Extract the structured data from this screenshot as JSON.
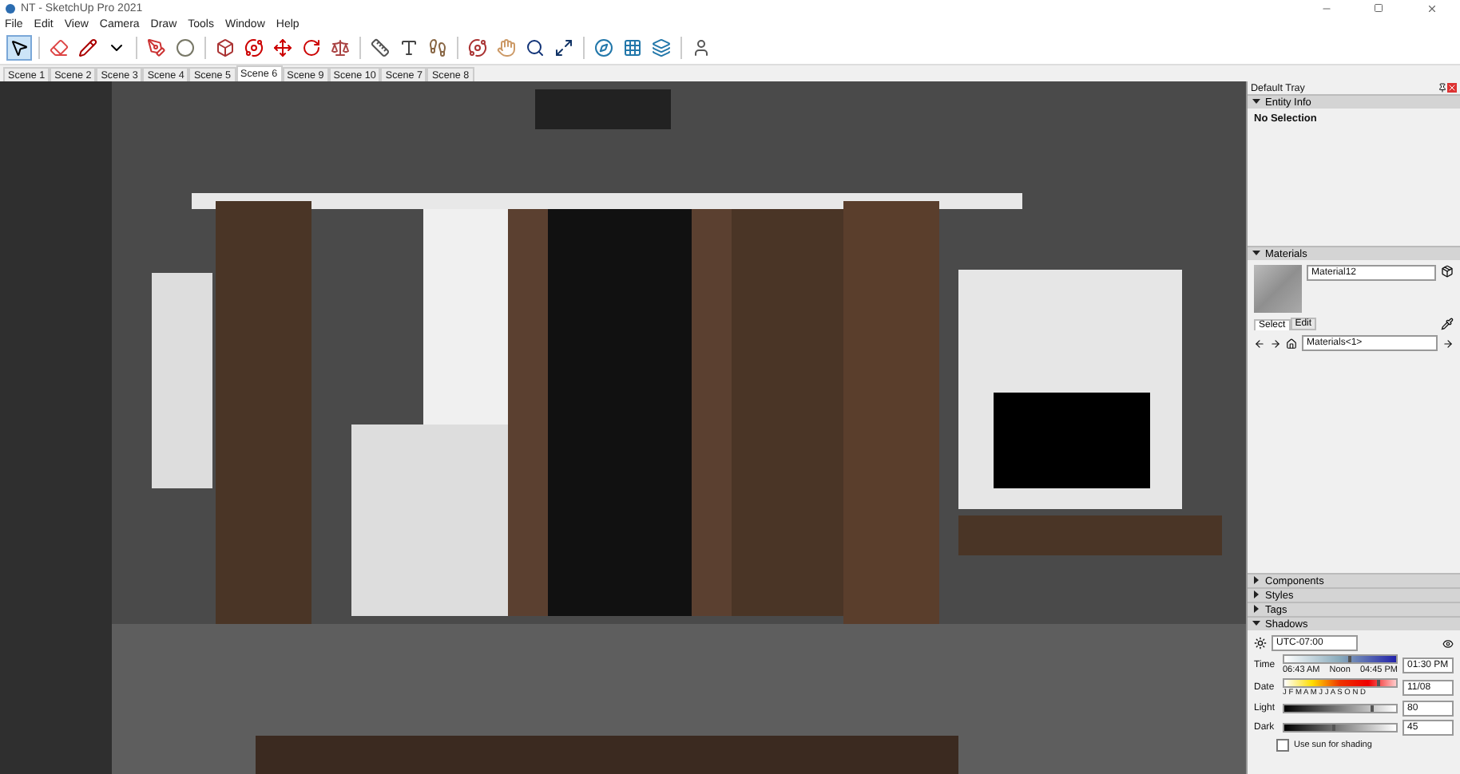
{
  "window": {
    "title": "NT - SketchUp Pro 2021"
  },
  "menu": [
    "File",
    "Edit",
    "View",
    "Camera",
    "Draw",
    "Tools",
    "Window",
    "Help"
  ],
  "toolbar": {
    "tools": [
      {
        "selected": true
      },
      {
        "selected": false
      },
      {
        "selected": false
      },
      {
        "selected": false
      },
      {
        "selected": false
      },
      {
        "selected": false
      },
      {
        "selected": false
      },
      {
        "selected": false
      },
      {
        "selected": false
      },
      {
        "selected": false
      },
      {
        "selected": false
      },
      {
        "selected": false
      },
      {
        "selected": false
      },
      {
        "selected": false
      },
      {
        "selected": false
      },
      {
        "selected": false
      },
      {
        "selected": false
      },
      {
        "selected": false
      },
      {
        "selected": false
      },
      {
        "selected": false
      },
      {
        "selected": false
      },
      {
        "selected": false
      }
    ]
  },
  "scenes": [
    {
      "label": "Scene 1",
      "selected": false
    },
    {
      "label": "Scene 2",
      "selected": false
    },
    {
      "label": "Scene 3",
      "selected": false
    },
    {
      "label": "Scene 4",
      "selected": false
    },
    {
      "label": "Scene 5",
      "selected": false
    },
    {
      "label": "Scene 6",
      "selected": true
    },
    {
      "label": "Scene 9",
      "selected": false
    },
    {
      "label": "Scene 10",
      "selected": false
    },
    {
      "label": "Scene 7",
      "selected": false
    },
    {
      "label": "Scene 8",
      "selected": false
    }
  ],
  "tray": {
    "title": "Default Tray",
    "entity_info": {
      "title": "Entity Info",
      "expanded": true,
      "text": "No Selection"
    },
    "materials": {
      "title": "Materials",
      "expanded": true,
      "name": "Material12",
      "tabs": [
        {
          "label": "Select",
          "selected": true
        },
        {
          "label": "Edit",
          "selected": false
        }
      ],
      "collection": "Materials<1>"
    },
    "collapsed": [
      {
        "title": "Components",
        "expanded": false
      },
      {
        "title": "Styles",
        "expanded": false
      },
      {
        "title": "Tags",
        "expanded": false
      }
    ],
    "shadows": {
      "title": "Shadows",
      "expanded": true,
      "timezone": "UTC-07:00",
      "time_label": "Time",
      "time_slider": {
        "level": 0.6
      },
      "time_marks": [
        "06:43 AM",
        "Noon",
        "04:45 PM"
      ],
      "time_value": "01:30 PM",
      "date_label": "Date",
      "date_slider": {
        "level": 0.85
      },
      "months": "J F M A M J J A S O N D",
      "date_value": "11/08",
      "light_label": "Light",
      "light_slider": {
        "level": 0.8
      },
      "light_value": "80",
      "dark_label": "Dark",
      "dark_slider": {
        "level": 0.45
      },
      "dark_value": "45",
      "use_sun": {
        "label": "Use sun for shading",
        "checked": false
      }
    }
  }
}
